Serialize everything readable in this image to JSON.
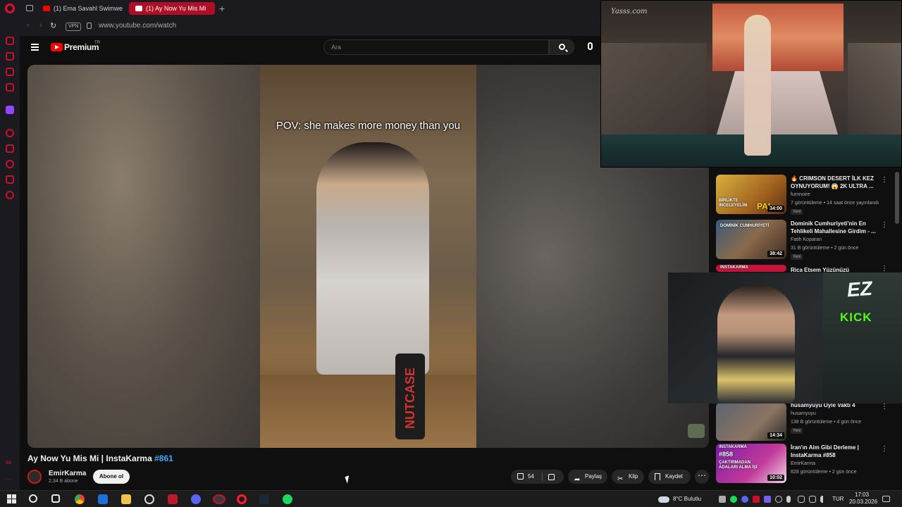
{
  "browser": {
    "tabs": [
      {
        "label": "(1) Ema Savahl Swimwear"
      },
      {
        "label": "(1) Ay Now Yu Mis Mi"
      }
    ],
    "new_tab": "+",
    "vpn_label": "VPN",
    "url": "www.youtube.com/watch"
  },
  "youtube_header": {
    "logo_text": "Premium",
    "logo_region": "TR",
    "search_placeholder": "Ara"
  },
  "video": {
    "caption": "POV: she makes more money than you",
    "can_label": "NUTCASE",
    "title": "Ay Now Yu Mis Mi | InstaKarma",
    "title_hashtag": "#861",
    "channel_name": "EmirKarma",
    "channel_subs": "2,34 B abone",
    "subscribe_label": "Abone ol",
    "like_count": "54",
    "share_label": "Paylaş",
    "clip_label": "Klip",
    "save_label": "Kaydet",
    "more_label": "⋯"
  },
  "overlay_runway": {
    "watermark": "Yasss.com"
  },
  "recommendations": [
    {
      "title": "🔥 CRIMSON DESERT İLK KEZ OYNUYORUM! 😱 2K ULTRA ...",
      "channel": "furnnoire",
      "meta": "7 görüntüleme • 14 saat önce yayınlandı",
      "badge": "Yeni",
      "duration": "34:00",
      "thumb_text": "BİRLİKTE İNCELEYELİM",
      "thumb_text2": "PAI"
    },
    {
      "title": "Dominik Cumhuriyeti'nin En Tehlikeli Mahallesine Girdim - ...",
      "channel": "Fatih Koparan",
      "meta": "31 B görüntüleme • 2 gün önce",
      "badge": "Yeni",
      "duration": "38:42",
      "thumb_text": "DOMİNİK CUMHURİYETİ"
    },
    {
      "title": "Rica Etsem Yüzünüzü",
      "thumb_text": "INSTAKARMA"
    },
    {
      "title": "husamyuyu Oyle Vakti 4",
      "channel": "husamyuyu",
      "meta": "138 B görüntüleme • 4 gün önce",
      "badge": "Yeni",
      "duration": "14:34"
    },
    {
      "title": "İran'ın Aim Gibi Derleme | InstaKarma #858",
      "channel": "EmirKarma",
      "meta": "828 görüntüleme • 2 gün önce",
      "duration": "10:02",
      "thumb_text": "INSTAKARMA",
      "thumb_text2": "#858",
      "thumb_text3": "ÇAKTIRMADAN ADALARI ALMA İŞİ"
    }
  ],
  "overlay_cam": {
    "logo_text": "EZ",
    "platform": "KICK"
  },
  "taskbar": {
    "weather": "8°C Bulutlu",
    "language": "TUR",
    "time": "17:03",
    "date": "20.03.2026"
  },
  "colors": {
    "accent_red": "#ff0000",
    "opera_red": "#e0102e",
    "link_blue": "#3ea6ff",
    "kick_green": "#53fc18"
  }
}
